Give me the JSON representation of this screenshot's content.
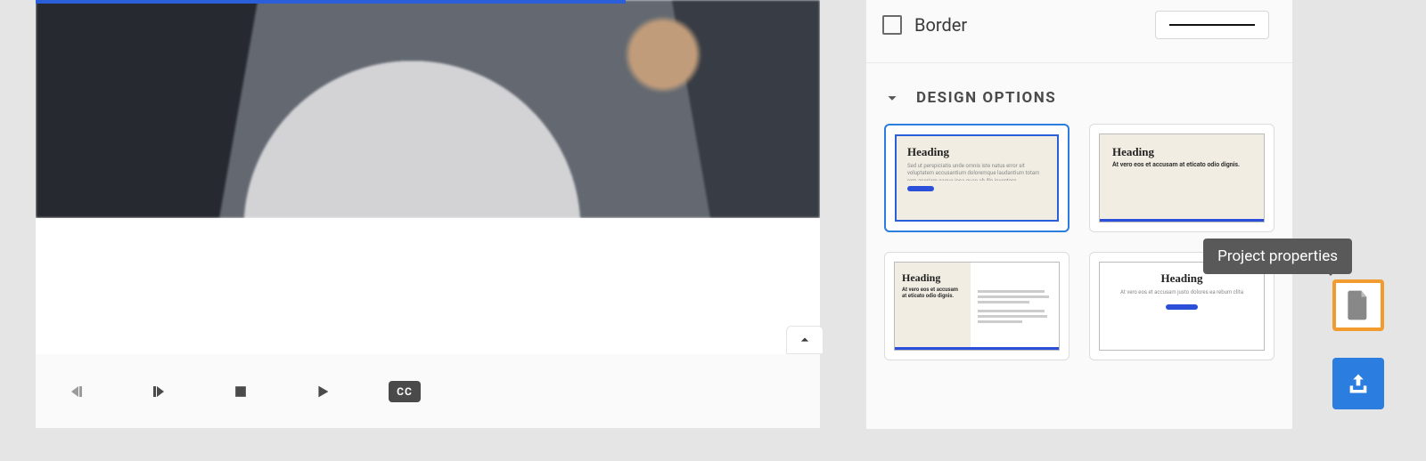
{
  "panel": {
    "border_label": "Border",
    "section_title": "DESIGN OPTIONS",
    "design_options": [
      {
        "heading": "Heading",
        "subtitle": ""
      },
      {
        "heading": "Heading",
        "subtitle": "At vero eos et accusam at eticato odio dignis."
      },
      {
        "heading": "Heading",
        "subtitle": "At vero eos et accusam at eticato odio dignis."
      },
      {
        "heading": "Heading",
        "subtitle": ""
      }
    ]
  },
  "tooltip": {
    "project_properties": "Project properties"
  },
  "transport": {
    "cc_label": "CC"
  }
}
